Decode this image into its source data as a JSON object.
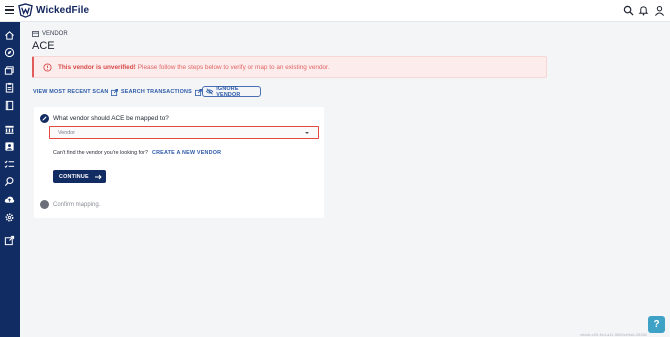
{
  "app": {
    "name": "WickedFile"
  },
  "header": {
    "icons": [
      "menu-icon",
      "wickedfile-logo-icon",
      "search-icon",
      "bell-icon",
      "user-icon"
    ]
  },
  "sidebar": {
    "icons": [
      "home-icon",
      "compass-icon",
      "stack-icon",
      "clipboard-icon",
      "book-icon",
      "bank-icon",
      "contact-icon",
      "checklist-icon",
      "search-icon",
      "cloud-upload-icon",
      "gear-icon",
      "external-link-icon"
    ],
    "background": "#112b63"
  },
  "breadcrumb": {
    "section": "VENDOR"
  },
  "page": {
    "title": "ACE"
  },
  "alert": {
    "strong": "This vendor is unverified!",
    "message": "Please follow the steps below to verify or map to an existing vendor.",
    "color": "#d94848"
  },
  "actions": {
    "view_scan": "VIEW MOST RECENT SCAN",
    "search_transactions": "SEARCH TRANSACTIONS",
    "ignore_vendor": "IGNORE VENDOR"
  },
  "step1": {
    "question": "What vendor should ACE be mapped to?",
    "select_placeholder": "Vendor",
    "cant_find": "Can't find the vendor you're looking for?",
    "create_link": "CREATE A NEW VENDOR",
    "continue_label": "CONTINUE"
  },
  "step2": {
    "label": "Confirm mapping."
  },
  "help": {
    "label": "?"
  },
  "footer": {
    "text": "vbsdk-v53-fix4-a11-5890ce9a6-28282"
  },
  "colors": {
    "primary": "#112b63",
    "link": "#2d5aa8",
    "error": "#e24a3b",
    "help": "#3ea2c6"
  }
}
